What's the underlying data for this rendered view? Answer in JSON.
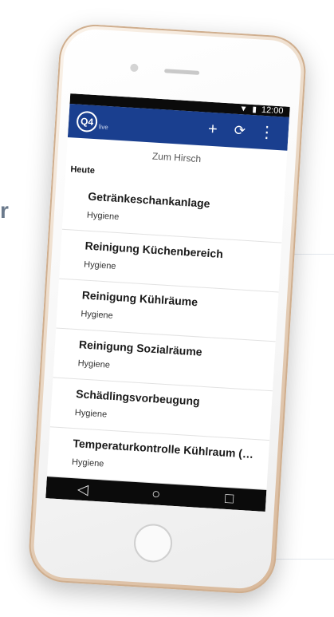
{
  "background": {
    "partial_text": "r"
  },
  "status_bar": {
    "time": "12:00",
    "icons": [
      "wifi-icon",
      "battery-icon"
    ]
  },
  "app_bar": {
    "logo_text": "Q4",
    "logo_sub": "live",
    "actions": [
      {
        "name": "add-icon",
        "glyph": "+"
      },
      {
        "name": "sync-icon",
        "glyph": "⟳"
      },
      {
        "name": "overflow-menu-icon",
        "glyph": "⋮"
      }
    ],
    "color": "#1a3f8f"
  },
  "location": "Zum Hirsch",
  "section_header": "Heute",
  "tasks": [
    {
      "title": "Getränkeschankanlage",
      "category": "Hygiene"
    },
    {
      "title": "Reinigung Küchenbereich",
      "category": "Hygiene"
    },
    {
      "title": "Reinigung Kühlräume",
      "category": "Hygiene"
    },
    {
      "title": "Reinigung Sozialräume",
      "category": "Hygiene"
    },
    {
      "title": "Schädlingsvorbeugung",
      "category": "Hygiene"
    },
    {
      "title": "Temperaturkontrolle Kühlraum (ma...",
      "category": "Hygiene"
    }
  ],
  "nav_bar": {
    "back": "◁",
    "home": "○",
    "recents": "□"
  }
}
